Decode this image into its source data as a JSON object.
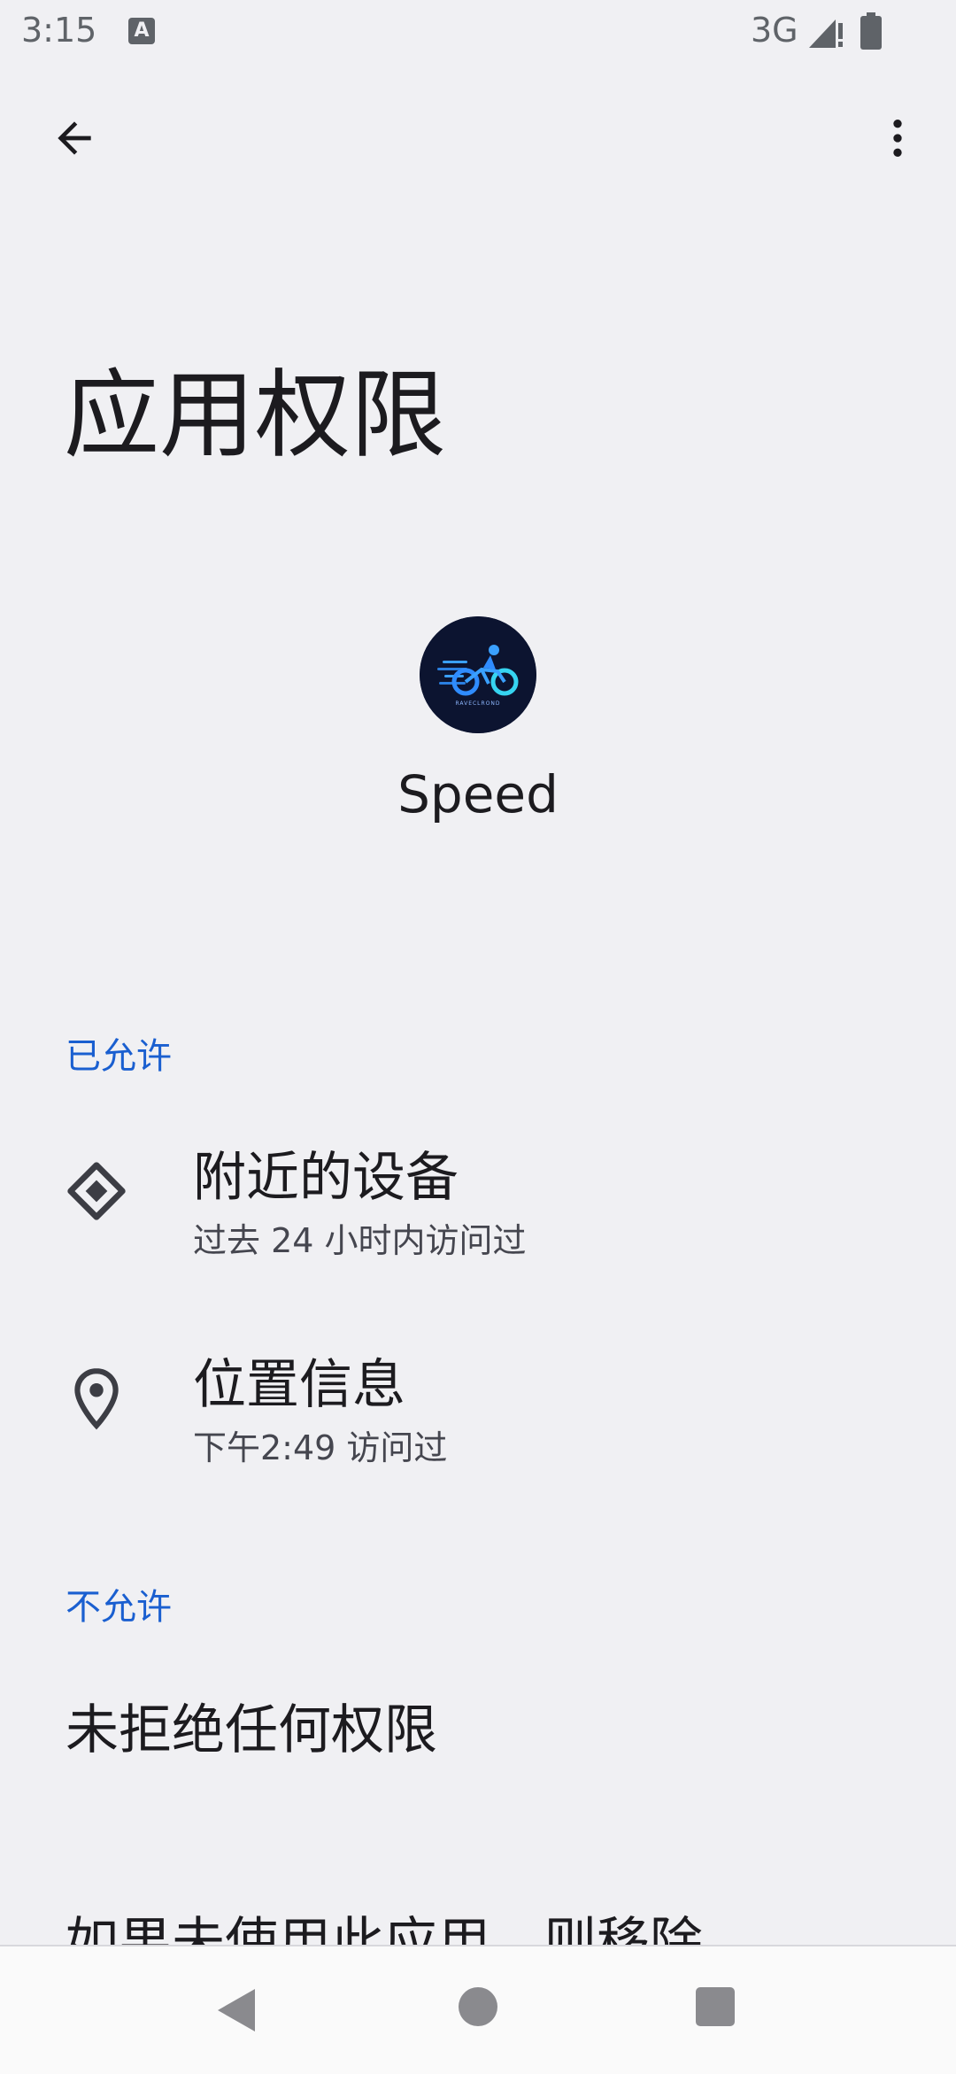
{
  "status_bar": {
    "time": "3:15",
    "notification_icon_letter": "A",
    "network": "3G"
  },
  "app_bar": {
    "back_icon": "arrow-back-icon",
    "more_icon": "more-vert-icon"
  },
  "page": {
    "title": "应用权限"
  },
  "app": {
    "name": "Speed",
    "icon": "cyclist-logo-icon"
  },
  "sections": {
    "allowed": {
      "header": "已允许",
      "items": [
        {
          "title": "附近的设备",
          "subtitle": "过去 24 小时内访问过",
          "icon": "nearby-devices-icon"
        },
        {
          "title": "位置信息",
          "subtitle": "下午2:49 访问过",
          "icon": "location-pin-icon"
        }
      ]
    },
    "denied": {
      "header": "不允许",
      "empty_text": "未拒绝任何权限"
    }
  },
  "footer_text": "如果未使用此应用，则移除",
  "colors": {
    "background": "#f0f0f3",
    "accent": "#1a5fd0",
    "text_primary": "#1c1b1f",
    "text_secondary": "#45464f"
  },
  "nav_bar": {
    "back": "nav-back-icon",
    "home": "nav-home-icon",
    "recents": "nav-recents-icon"
  }
}
